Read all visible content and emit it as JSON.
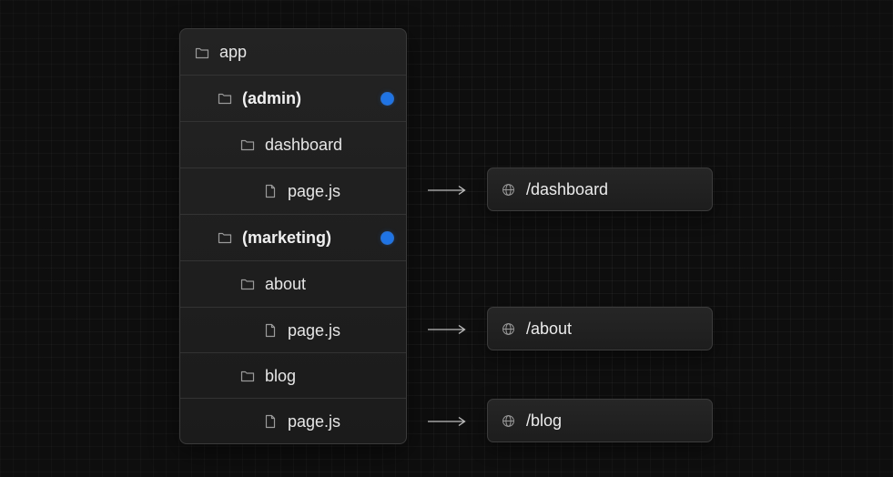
{
  "tree": {
    "rows": [
      {
        "label": "app",
        "icon": "folder-icon",
        "depth": 0
      },
      {
        "label": "(admin)",
        "icon": "folder-icon",
        "depth": 1,
        "group": true
      },
      {
        "label": "dashboard",
        "icon": "folder-icon",
        "depth": 2
      },
      {
        "label": "page.js",
        "icon": "file-icon",
        "depth": 3
      },
      {
        "label": "(marketing)",
        "icon": "folder-icon",
        "depth": 1,
        "group": true
      },
      {
        "label": "about",
        "icon": "folder-icon",
        "depth": 2
      },
      {
        "label": "page.js",
        "icon": "file-icon",
        "depth": 3
      },
      {
        "label": "blog",
        "icon": "folder-icon",
        "depth": 2
      },
      {
        "label": "page.js",
        "icon": "file-icon",
        "depth": 3
      }
    ],
    "group_marker_color": "#1f74e5"
  },
  "routes": [
    {
      "label": "/dashboard",
      "icon": "globe-icon",
      "from_row": 3
    },
    {
      "label": "/about",
      "icon": "globe-icon",
      "from_row": 6
    },
    {
      "label": "/blog",
      "icon": "globe-icon",
      "from_row": 8
    }
  ]
}
